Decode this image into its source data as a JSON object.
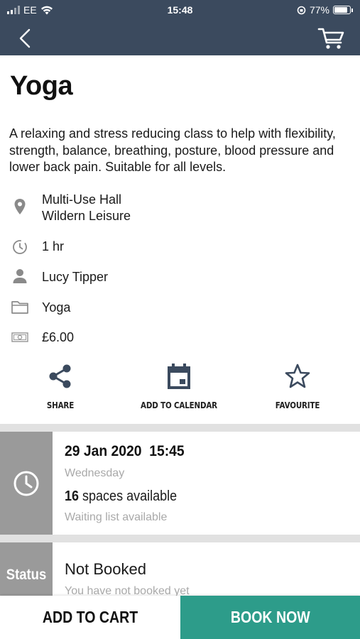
{
  "status_bar": {
    "carrier": "EE",
    "time": "15:48",
    "battery": "77%"
  },
  "class": {
    "title": "Yoga",
    "description": "A relaxing and stress reducing class to help with flexibility, strength, balance, breathing, posture, blood pressure and lower back pain. Suitable for all levels.",
    "location_line1": "Multi-Use Hall",
    "location_line2": "Wildern Leisure",
    "duration": "1 hr",
    "instructor": "Lucy Tipper",
    "category": "Yoga",
    "price": "£6.00"
  },
  "actions": {
    "share": "SHARE",
    "calendar": "ADD TO CALENDAR",
    "favourite": "FAVOURITE"
  },
  "session": {
    "date": "29 Jan 2020",
    "time": "15:45",
    "day": "Wednesday",
    "spaces_count": "16",
    "spaces_text": "spaces available",
    "waiting": "Waiting list available"
  },
  "status": {
    "label": "Status",
    "value": "Not Booked",
    "sub": "You have not booked yet"
  },
  "buttons": {
    "add_to_cart": "ADD TO CART",
    "book_now": "BOOK NOW"
  },
  "colors": {
    "header": "#3b4a5e",
    "accent": "#2d9c8a",
    "side_panel": "#9a9a9a"
  },
  "icons": [
    "back-icon",
    "cart-icon",
    "location-pin-icon",
    "timer-icon",
    "person-icon",
    "folder-icon",
    "money-icon",
    "share-icon",
    "calendar-icon",
    "star-icon",
    "clock-icon"
  ]
}
